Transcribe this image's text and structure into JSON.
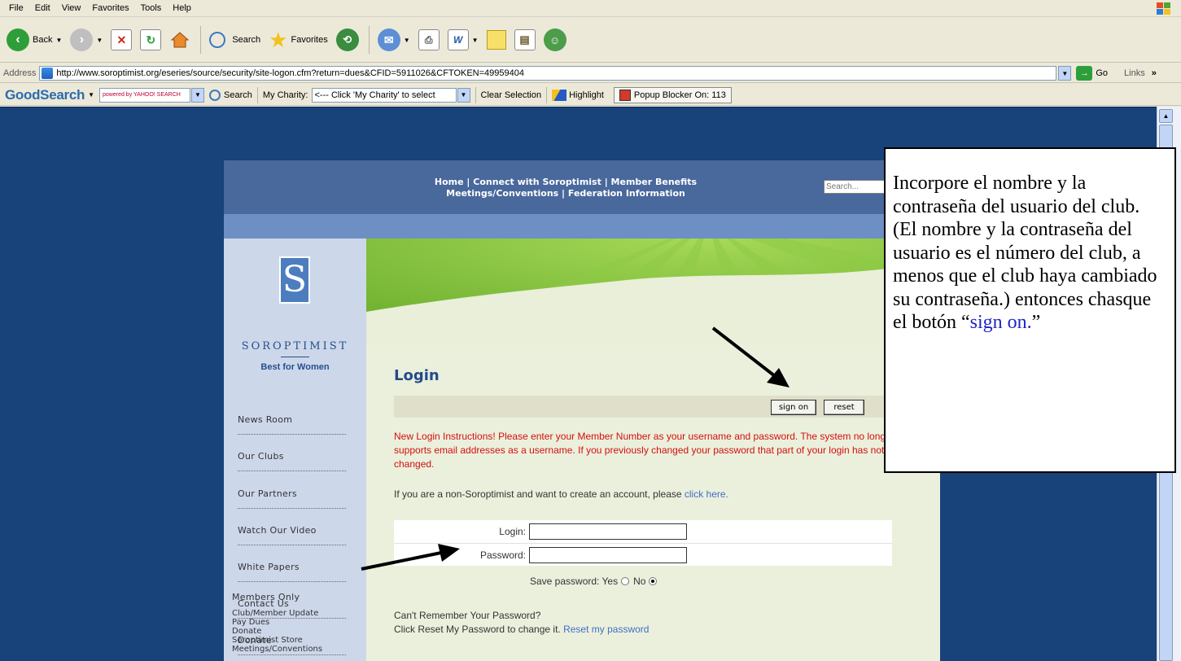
{
  "menubar": {
    "items": [
      "File",
      "Edit",
      "View",
      "Favorites",
      "Tools",
      "Help"
    ]
  },
  "toolbar": {
    "back_label": "Back",
    "search_label": "Search",
    "favorites_label": "Favorites"
  },
  "addressbar": {
    "label": "Address",
    "url": "http://www.soroptimist.org/eseries/source/security/site-logon.cfm?return=dues&CFID=5911026&CFTOKEN=49959404",
    "go_label": "Go",
    "links_label": "Links"
  },
  "goodsearch": {
    "logo": "GoodSearch",
    "powered": "powered by YAHOO! SEARCH",
    "search_label": "Search",
    "my_charity_label": "My Charity:",
    "charity_placeholder": "<--- Click 'My Charity' to select",
    "clear_label": "Clear Selection",
    "highlight_label": "Highlight",
    "popup_label": "Popup Blocker On: 113"
  },
  "site": {
    "nav_line1": "Home  |  Connect with Soroptimist  |  Member Benefits",
    "nav_line2": "Meetings/Conventions  |  Federation Information",
    "search_placeholder": "Search...",
    "logo_letter": "S",
    "logo_word": "SOROPTIMIST",
    "logo_tagline": "Best for Women",
    "sidebar_items": [
      "News Room",
      "Our Clubs",
      "Our Partners",
      "Watch Our Video",
      "White Papers",
      "Contact Us",
      "Donate"
    ],
    "members_title": "Members Only",
    "members_links": [
      "Club/Member Update",
      "Pay Dues",
      "Donate",
      "Soroptimist Store",
      "Meetings/Conventions"
    ]
  },
  "login": {
    "title": "Login",
    "sign_on_label": "sign on",
    "reset_label": "reset",
    "notice": "New Login Instructions! Please enter your Member Number as your username and password. The system no longer supports email addresses as a username. If you previously changed your password that part of your login has not changed.",
    "nonsorop_text": "If you are a non-Soroptimist and want to create an account, please ",
    "nonsorop_link": "click here.",
    "login_label": "Login:",
    "password_label": "Password:",
    "save_password_label": "Save password: Yes",
    "no_label": "No",
    "forgot_line1": "Can't Remember Your Password?",
    "forgot_line2": "Click Reset My Password to change it. ",
    "reset_link": "Reset my password"
  },
  "annotation": {
    "text": "Incorpore el nombre y la contraseña del usuario del club. (El nombre y la contraseña del usuario es el número del club, a menos que el club haya cambiado su contraseña.) entonces chasque el botón “",
    "highlight": "sign on.",
    "closing": "”"
  },
  "colors": {
    "page_bg": "#17427a",
    "header_bg": "#49689c",
    "notice_red": "#d40f0f",
    "link_blue": "#3f6fc7",
    "title_blue": "#244b8b"
  }
}
